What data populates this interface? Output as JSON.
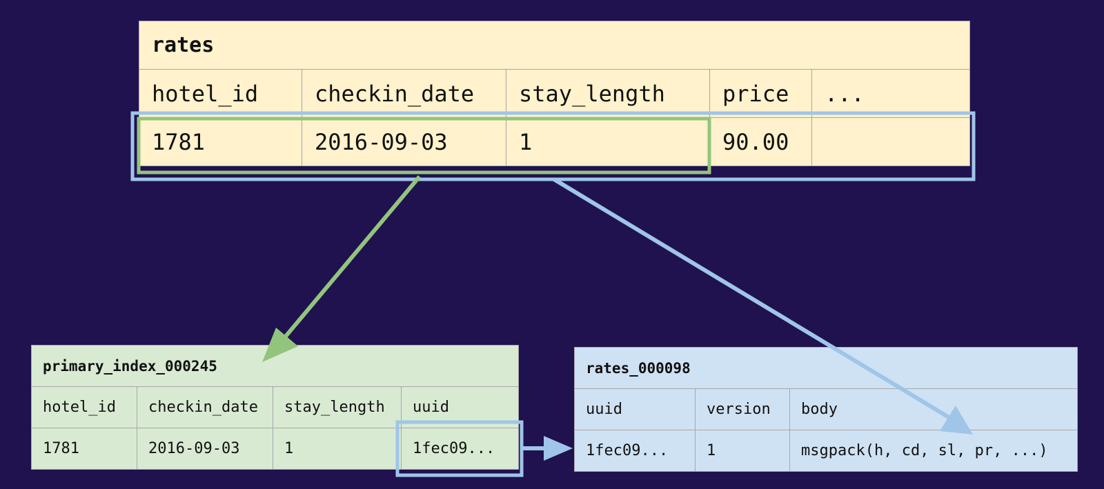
{
  "main_table": {
    "title": "rates",
    "headers": [
      "hotel_id",
      "checkin_date",
      "stay_length",
      "price",
      "..."
    ],
    "row": [
      "1781",
      "2016-09-03",
      "1",
      "90.00",
      ""
    ]
  },
  "index_table": {
    "title": "primary_index_000245",
    "headers": [
      "hotel_id",
      "checkin_date",
      "stay_length",
      "uuid"
    ],
    "row": [
      "1781",
      "2016-09-03",
      "1",
      "1fec09..."
    ]
  },
  "shard_table": {
    "title": "rates_000098",
    "headers": [
      "uuid",
      "version",
      "body"
    ],
    "row": [
      "1fec09...",
      "1",
      "msgpack(h, cd, sl, pr, ...)"
    ]
  },
  "colors": {
    "background": "#20114f",
    "main_table_fill": "#fff2cc",
    "index_table_fill": "#d9ead3",
    "shard_table_fill": "#cfe2f3",
    "green_highlight": "#93c47d",
    "blue_highlight": "#9fc5e8"
  }
}
